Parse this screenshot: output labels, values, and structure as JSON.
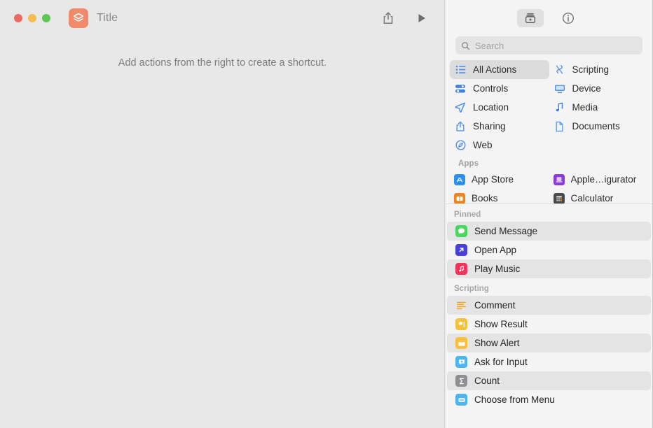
{
  "window": {
    "title": "Title",
    "app_icon_color": "#f08a6b",
    "traffic_lights": [
      {
        "name": "close",
        "color": "#ec6a5f"
      },
      {
        "name": "minimize",
        "color": "#f4bd4f"
      },
      {
        "name": "maximize",
        "color": "#61c554"
      }
    ],
    "toolbar": [
      {
        "name": "share-icon",
        "label": "Share"
      },
      {
        "name": "play-icon",
        "label": "Run"
      }
    ]
  },
  "canvas": {
    "empty_message": "Add actions from the right to create a shortcut."
  },
  "sidebar": {
    "toolbar": [
      {
        "name": "action-library-icon",
        "label": "Action Library",
        "selected": true
      },
      {
        "name": "info-icon",
        "label": "Shortcut Details",
        "selected": false
      }
    ],
    "search": {
      "placeholder": "Search",
      "value": "",
      "icon": "search-icon"
    },
    "categories": {
      "left": [
        {
          "label": "All Actions",
          "icon": "list-bullet-icon",
          "color": "#4a90e8",
          "selected": true
        },
        {
          "label": "Controls",
          "icon": "sliders-icon",
          "color": "#3f7fe0",
          "selected": false
        },
        {
          "label": "Location",
          "icon": "paperplane-icon",
          "color": "#4b8df0",
          "selected": false
        },
        {
          "label": "Sharing",
          "icon": "share-up-icon",
          "color": "#5b9bf2",
          "selected": false
        },
        {
          "label": "Web",
          "icon": "compass-icon",
          "color": "#4d8ef0",
          "selected": false
        }
      ],
      "right": [
        {
          "label": "Scripting",
          "icon": "script-icon",
          "color": "#5b8ff0",
          "selected": false
        },
        {
          "label": "Device",
          "icon": "display-icon",
          "color": "#4d8ef0",
          "selected": false
        },
        {
          "label": "Media",
          "icon": "music-note-icon",
          "color": "#3f7fe0",
          "selected": false
        },
        {
          "label": "Documents",
          "icon": "document-icon",
          "color": "#5b9bf2",
          "selected": false
        }
      ]
    },
    "apps_section": {
      "header": "Apps",
      "left": [
        {
          "label": "App Store",
          "icon": "app-store-icon",
          "color": "#2f8fef"
        },
        {
          "label": "Books",
          "icon": "books-icon",
          "color": "#f0851f"
        }
      ],
      "right": [
        {
          "label": "Apple…igurator",
          "icon": "apple-configurator-icon",
          "color": "#8b3bd6"
        },
        {
          "label": "Calculator",
          "icon": "calculator-icon",
          "color": "#4a4a4a"
        }
      ]
    },
    "pinned_section": {
      "header": "Pinned",
      "items": [
        {
          "label": "Send Message",
          "icon": "messages-icon",
          "color": "#4bd561",
          "alt": true
        },
        {
          "label": "Open App",
          "icon": "open-app-icon",
          "color": "#4a40d8",
          "alt": false
        },
        {
          "label": "Play Music",
          "icon": "music-icon",
          "color": "#f4335b",
          "alt": true
        }
      ]
    },
    "scripting_section": {
      "header": "Scripting",
      "items": [
        {
          "label": "Comment",
          "icon": "comment-lines-icon",
          "color": "#f5a623",
          "alt": true
        },
        {
          "label": "Show Result",
          "icon": "show-result-icon",
          "color": "#f7c13c",
          "alt": false
        },
        {
          "label": "Show Alert",
          "icon": "show-alert-icon",
          "color": "#f7c13c",
          "alt": true
        },
        {
          "label": "Ask for Input",
          "icon": "ask-input-icon",
          "color": "#4cb5f0",
          "alt": false
        },
        {
          "label": "Count",
          "icon": "count-sigma-icon",
          "color": "#8e8e93",
          "alt": true
        },
        {
          "label": "Choose from Menu",
          "icon": "choose-menu-icon",
          "color": "#4cb5f0",
          "alt": false
        }
      ]
    }
  }
}
